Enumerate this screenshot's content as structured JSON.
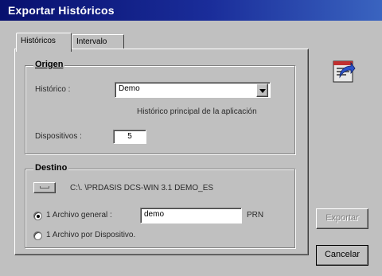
{
  "window": {
    "title": "Exportar Históricos"
  },
  "tabs": [
    {
      "label": "Históricos",
      "active": true
    },
    {
      "label": "Intervalo",
      "active": false
    }
  ],
  "origen": {
    "group_label": "Origen",
    "historico_label": "Histórico :",
    "historico_value": "Demo",
    "historico_description": "Histórico principal de la aplicación",
    "dispositivos_label": "Dispositivos :",
    "dispositivos_value": "5"
  },
  "destino": {
    "group_label": "Destino",
    "path": "C:\\. \\PRDASIS DCS-WIN 3.1 DEMO_ES",
    "option_general_label": "1 Archivo general :",
    "option_general_value": "demo",
    "option_general_ext": "PRN",
    "option_dispositivo_label": "1 Archivo por Dispositivo.",
    "selected": "general"
  },
  "buttons": {
    "export_label": "Exportar",
    "export_enabled": false,
    "cancel_label": "Cancelar"
  },
  "icons": {
    "export": "export-data-icon",
    "folder": "folder-button-icon",
    "dropdown": "chevron-down-icon"
  }
}
